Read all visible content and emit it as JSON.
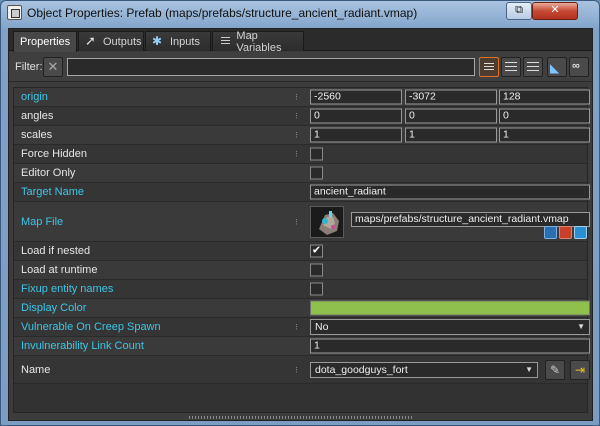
{
  "window": {
    "title": "Object Properties: Prefab (maps/prefabs/structure_ancient_radiant.vmap)",
    "restore_label": "⧉",
    "close_label": "✕"
  },
  "tabs": [
    {
      "label": "Properties",
      "icon": "none"
    },
    {
      "label": "Outputs",
      "icon": "outputs-arrow-icon"
    },
    {
      "label": "Inputs",
      "icon": "inputs-icon"
    },
    {
      "label": "Map Variables",
      "icon": "map-variables-icon"
    }
  ],
  "filter": {
    "label": "Filter:",
    "value": "",
    "clear_glyph": "✕"
  },
  "properties": {
    "origin": {
      "label": "origin",
      "values": [
        "-2560",
        "-3072",
        "128"
      ]
    },
    "angles": {
      "label": "angles",
      "values": [
        "0",
        "0",
        "0"
      ]
    },
    "scales": {
      "label": "scales",
      "values": [
        "1",
        "1",
        "1"
      ]
    },
    "force_hidden": {
      "label": "Force Hidden",
      "checked": false
    },
    "editor_only": {
      "label": "Editor Only",
      "checked": false
    },
    "target_name": {
      "label": "Target Name",
      "value": "ancient_radiant"
    },
    "map_file": {
      "label": "Map File",
      "value": "maps/prefabs/structure_ancient_radiant.vmap"
    },
    "load_if_nested": {
      "label": "Load if nested",
      "checked": true,
      "check_glyph": "✔"
    },
    "load_at_runtime": {
      "label": "Load at runtime",
      "checked": false
    },
    "fixup_entity_names": {
      "label": "Fixup entity names",
      "checked": false
    },
    "display_color": {
      "label": "Display Color",
      "color": "#8fc04b"
    },
    "vulnerable_on_creep_spawn": {
      "label": "Vulnerable On Creep Spawn",
      "value": "No"
    },
    "invulnerability_link_count": {
      "label": "Invulnerability Link Count",
      "value": "1"
    },
    "name": {
      "label": "Name",
      "value": "dota_goodguys_fort"
    }
  },
  "colors": {
    "cyan_label": "#3cc6e6",
    "active_toggle": "#e07020"
  }
}
